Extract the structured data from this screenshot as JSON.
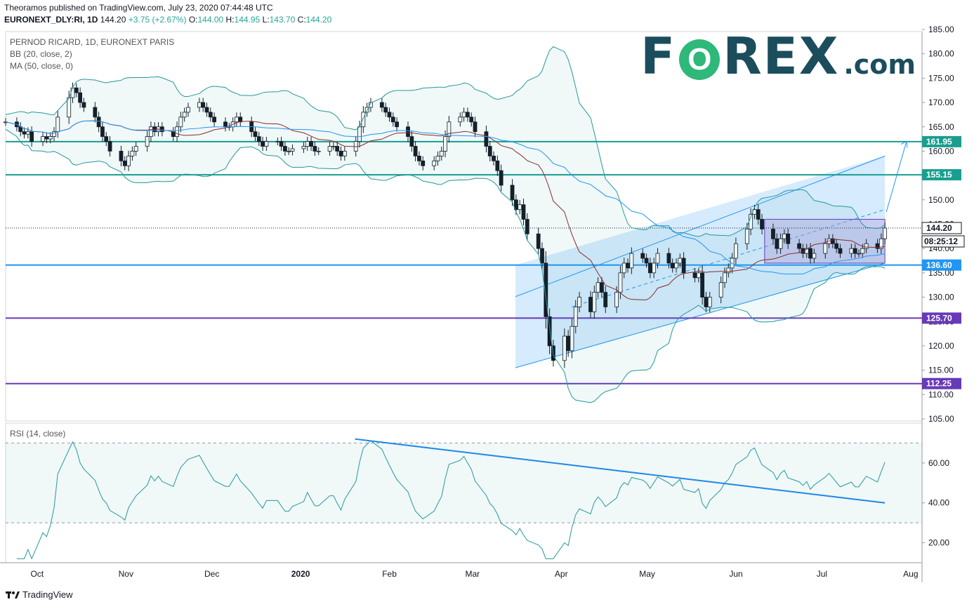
{
  "header": {
    "published": "Theoramos published on TradingView.com, July 23, 2020 07:44:48 UTC",
    "symbol": "EURONEXT_DLY:RI, 1D",
    "last": "144.20",
    "change": "+3.75 (+2.67%)",
    "o_label": "O:",
    "o_value": "144.00",
    "h_label": "H:",
    "h_value": "144.95",
    "l_label": "L:",
    "l_value": "143.70",
    "c_label": "C:",
    "c_value": "144.20"
  },
  "legend": {
    "title": "PERNOD RICARD, 1D, EURONEXT PARIS",
    "bb": "BB (20, close, 2)",
    "ma": "MA (50, close, 0)",
    "rsi": "RSI (14, close)"
  },
  "logo": {
    "brand_pre": "F",
    "brand_o": "O",
    "brand_post": "REX",
    "brand_suffix": ".com"
  },
  "footer": {
    "label": "TradingView"
  },
  "colors": {
    "up": "#ffffff",
    "down": "#131722",
    "teal": "#199e8f",
    "blue": "#2196f3",
    "purple": "#673ab7",
    "bb": "#26999b",
    "ma": "#8b2c2c",
    "channel": "#bbdefb"
  },
  "chart_data": {
    "type": "candlestick",
    "price_axis": {
      "range": [
        105,
        185
      ],
      "ticks": [
        "185.00",
        "180.00",
        "175.00",
        "170.00",
        "165.00",
        "160.00",
        "155.00",
        "150.00",
        "145.00",
        "140.00",
        "135.00",
        "130.00",
        "125.00",
        "120.00",
        "115.00",
        "110.00",
        "105.00"
      ]
    },
    "x_axis": {
      "labels": [
        "Oct",
        "Nov",
        "Dec",
        "2020",
        "Feb",
        "Mar",
        "Apr",
        "May",
        "Jun",
        "Jul",
        "Aug"
      ]
    },
    "levels": [
      {
        "value": 161.95,
        "label": "161.95",
        "color": "#199e8f"
      },
      {
        "value": 155.15,
        "label": "155.15",
        "color": "#199e8f"
      },
      {
        "value": 136.6,
        "label": "136.60",
        "color": "#2196f3"
      },
      {
        "value": 125.7,
        "label": "125.70",
        "color": "#673ab7"
      },
      {
        "value": 112.25,
        "label": "112.25",
        "color": "#673ab7"
      }
    ],
    "current_price": {
      "value": 144.2,
      "label": "144.20",
      "countdown": "08:25:12"
    },
    "rsi": {
      "range": [
        10,
        80
      ],
      "ticks": [
        "60.00",
        "40.00",
        "20.00"
      ],
      "bands": [
        30,
        70
      ],
      "trendline": [
        {
          "date": "2020-01-20",
          "value": 72
        },
        {
          "date": "2020-07-23",
          "value": 40
        }
      ]
    },
    "channel": {
      "start": {
        "date": "2020-03-16",
        "lower": 115.5,
        "upper": 136.6
      },
      "end": {
        "date": "2020-07-23",
        "lower": 137.0,
        "upper": 159.0
      }
    },
    "range_box": {
      "start": "2020-06-11",
      "end": "2020-07-23",
      "low": 137.0,
      "high": 146.0
    },
    "target_arrow": {
      "from": {
        "date": "2020-07-23",
        "value": 147.5
      },
      "to": {
        "date": "2020-08-01",
        "value": 162.0
      }
    },
    "close_series": [
      [
        166,
        165,
        164,
        163.5,
        164,
        162,
        163,
        162.5,
        163,
        164,
        167,
        171,
        173,
        172,
        170,
        169,
        167,
        165,
        163,
        162,
        160,
        158,
        157,
        159,
        160,
        161,
        163,
        165,
        164,
        165,
        164,
        163,
        165,
        167,
        168,
        169,
        170,
        169,
        168,
        167,
        166,
        165,
        165,
        166,
        167,
        166,
        164,
        163,
        162,
        161,
        162,
        162,
        161,
        160,
        160,
        160.5,
        161,
        162,
        161,
        160,
        160,
        161,
        161,
        160,
        159,
        160,
        162,
        165,
        168,
        169,
        170,
        169,
        168,
        167,
        166,
        165,
        163,
        161,
        159,
        158,
        157,
        158,
        159,
        160,
        163,
        166,
        167,
        168,
        167,
        166,
        164,
        161,
        159,
        158,
        156,
        153,
        150,
        148,
        149,
        146,
        143,
        140,
        137,
        126,
        120,
        117,
        122,
        119,
        124,
        128,
        130,
        127,
        131,
        133,
        131,
        128,
        131,
        135,
        137,
        136,
        139,
        138,
        137,
        135,
        137,
        139,
        137,
        136,
        137,
        138,
        135,
        134,
        135,
        130,
        128,
        130,
        133,
        135,
        136,
        138,
        141,
        144,
        147,
        148,
        146,
        144,
        142,
        140,
        142,
        143,
        141,
        140,
        139,
        140,
        138,
        139,
        141,
        142,
        141,
        140,
        139,
        140,
        139,
        139,
        140,
        141,
        140,
        142,
        144.2
      ]
    ]
  }
}
